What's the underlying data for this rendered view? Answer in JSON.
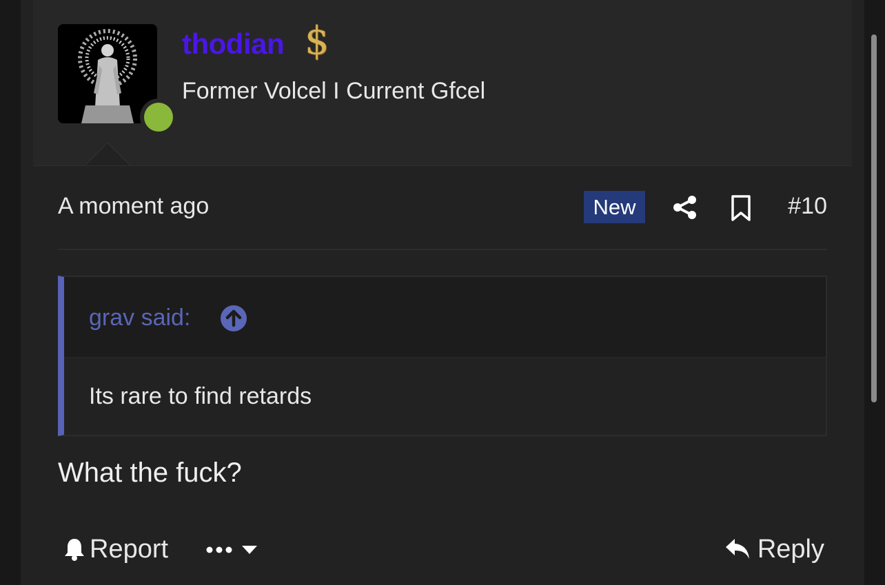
{
  "user": {
    "name": "thodian",
    "title": "Former Volcel I Current Gfcel",
    "status": "online",
    "badge_icon": "dollar-icon",
    "name_color": "#4a16e8"
  },
  "post": {
    "timestamp": "A moment ago",
    "new_badge": "New",
    "number": "#10",
    "body": "What the fuck?"
  },
  "quote": {
    "author": "grav said:",
    "text": "Its rare to find retards",
    "accent_color": "#5862b8"
  },
  "actions": {
    "report_label": "Report",
    "reply_label": "Reply"
  },
  "icons": {
    "share": "share-icon",
    "bookmark": "bookmark-icon",
    "quote_jump": "arrow-up-circle-icon",
    "report": "bell-icon",
    "more": "ellipsis-icon",
    "dropdown": "caret-down-icon",
    "reply": "reply-arrow-icon"
  }
}
